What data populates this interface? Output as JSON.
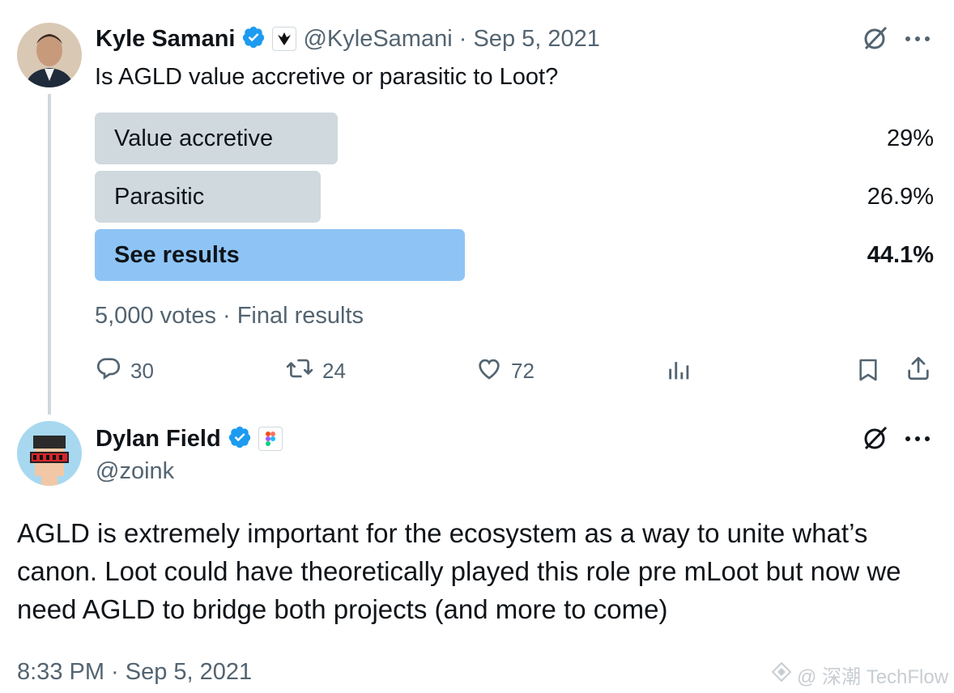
{
  "tweet1": {
    "author_name": "Kyle Samani",
    "handle": "@KyleSamani",
    "separator": "·",
    "date": "Sep 5, 2021",
    "text": "Is AGLD value accretive or parasitic to Loot?",
    "poll": {
      "options": [
        {
          "label": "Value accretive",
          "percent_label": "29%",
          "percent": 29
        },
        {
          "label": "Parasitic",
          "percent_label": "26.9%",
          "percent": 26.9
        },
        {
          "label": "See results",
          "percent_label": "44.1%",
          "percent": 44.1,
          "winner": true
        }
      ],
      "summary": "5,000 votes · Final results"
    },
    "actions": {
      "replies": "30",
      "retweets": "24",
      "likes": "72"
    }
  },
  "tweet2": {
    "author_name": "Dylan Field",
    "handle": "@zoink",
    "text": "AGLD is extremely important for the ecosystem as a way to unite what’s canon. Loot could have theoretically played this role pre mLoot but now we need AGLD to bridge both projects (and more to come)",
    "timestamp": "8:33 PM · Sep 5, 2021"
  },
  "watermark": "@ 深潮 TechFlow",
  "colors": {
    "accent_blue": "#1d9bf0",
    "poll_winner": "#8ec4f5",
    "poll_bar": "#cfd9de",
    "muted": "#536471"
  },
  "icons": [
    "verified-badge-icon",
    "grok-icon",
    "more-icon",
    "reply-icon",
    "retweet-icon",
    "like-icon",
    "views-icon",
    "bookmark-icon",
    "share-icon"
  ]
}
